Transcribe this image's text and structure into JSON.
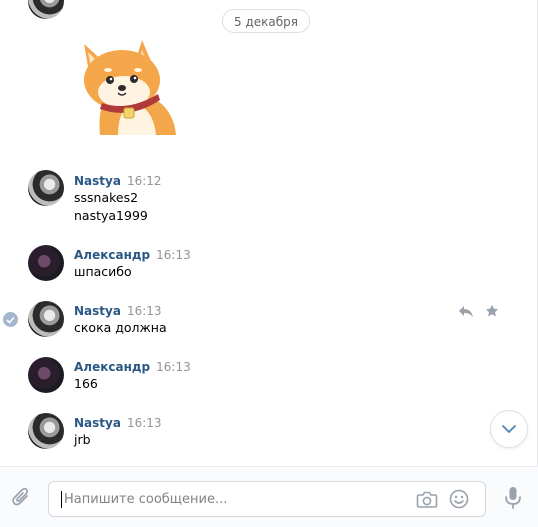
{
  "date_divider": "5 декабря",
  "messages": [
    {
      "author": "Nastya",
      "time": "16:12",
      "lines": [
        "sssnakes2",
        "nastya1999"
      ]
    },
    {
      "author": "Александр",
      "time": "16:13",
      "lines": [
        "шпасибо"
      ]
    },
    {
      "author": "Nastya",
      "time": "16:13",
      "lines": [
        "скока должна"
      ]
    },
    {
      "author": "Александр",
      "time": "16:13",
      "lines": [
        "166"
      ]
    },
    {
      "author": "Nastya",
      "time": "16:13",
      "lines": [
        "jrb"
      ]
    }
  ],
  "composer": {
    "placeholder": "Напишите сообщение..."
  },
  "icons": {
    "attach": "paperclip-icon",
    "camera": "camera-icon",
    "emoji": "emoji-icon",
    "voice": "microphone-icon",
    "reply": "reply-icon",
    "favorite": "star-icon",
    "scroll_down": "chevron-down-icon",
    "read": "check-icon"
  },
  "colors": {
    "author": "#2a5885",
    "time": "#939393",
    "icon": "#99a2ad",
    "accent": "#5181b8"
  }
}
